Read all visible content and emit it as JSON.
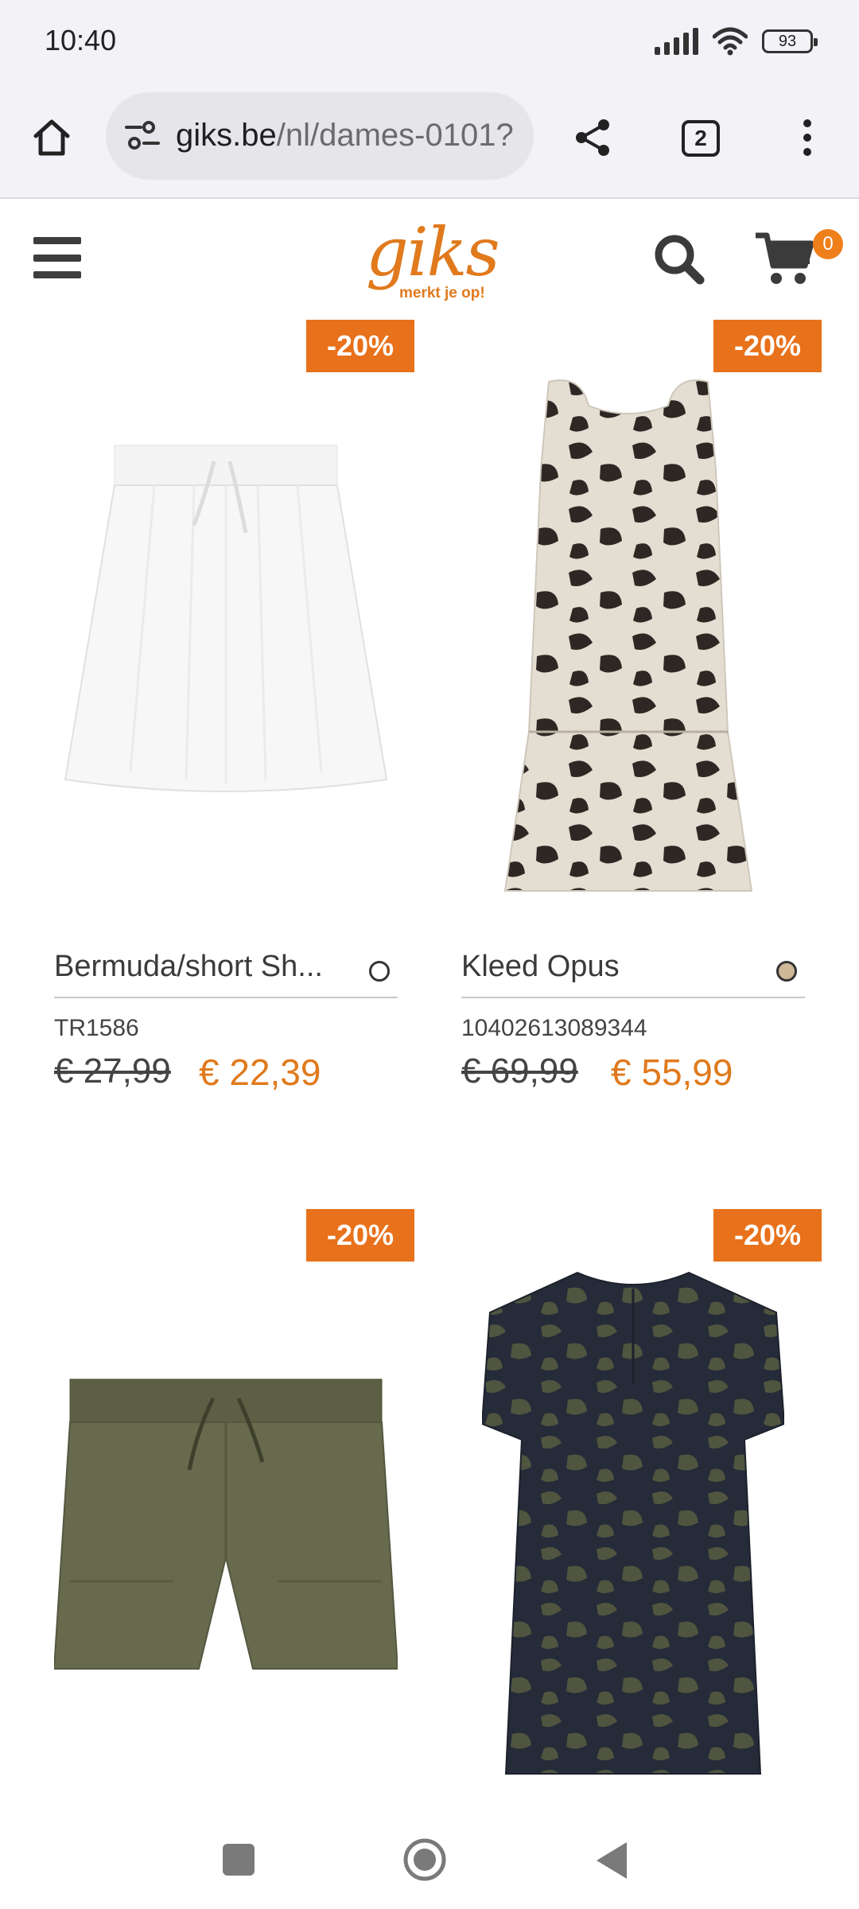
{
  "status_bar": {
    "time": "10:40",
    "battery": "93"
  },
  "browser": {
    "url_host": "giks.be",
    "url_path": "/nl/dames-0101?",
    "tab_count": "2"
  },
  "site": {
    "logo_word": "giks",
    "logo_tagline": "merkt je op!",
    "cart_count": "0"
  },
  "products": [
    {
      "discount": "-20%",
      "name": "Bermuda/short Sh...",
      "code": "TR1586",
      "old_price": "€ 27,99",
      "new_price": "€ 22,39",
      "swatch_color": "#ffffff"
    },
    {
      "discount": "-20%",
      "name": "Kleed Opus",
      "code": "10402613089344",
      "old_price": "€ 69,99",
      "new_price": "€ 55,99",
      "swatch_color": "#cfb896"
    },
    {
      "discount": "-20%"
    },
    {
      "discount": "-20%"
    }
  ],
  "colors": {
    "accent": "#e8711b",
    "price": "#e07a1d"
  }
}
